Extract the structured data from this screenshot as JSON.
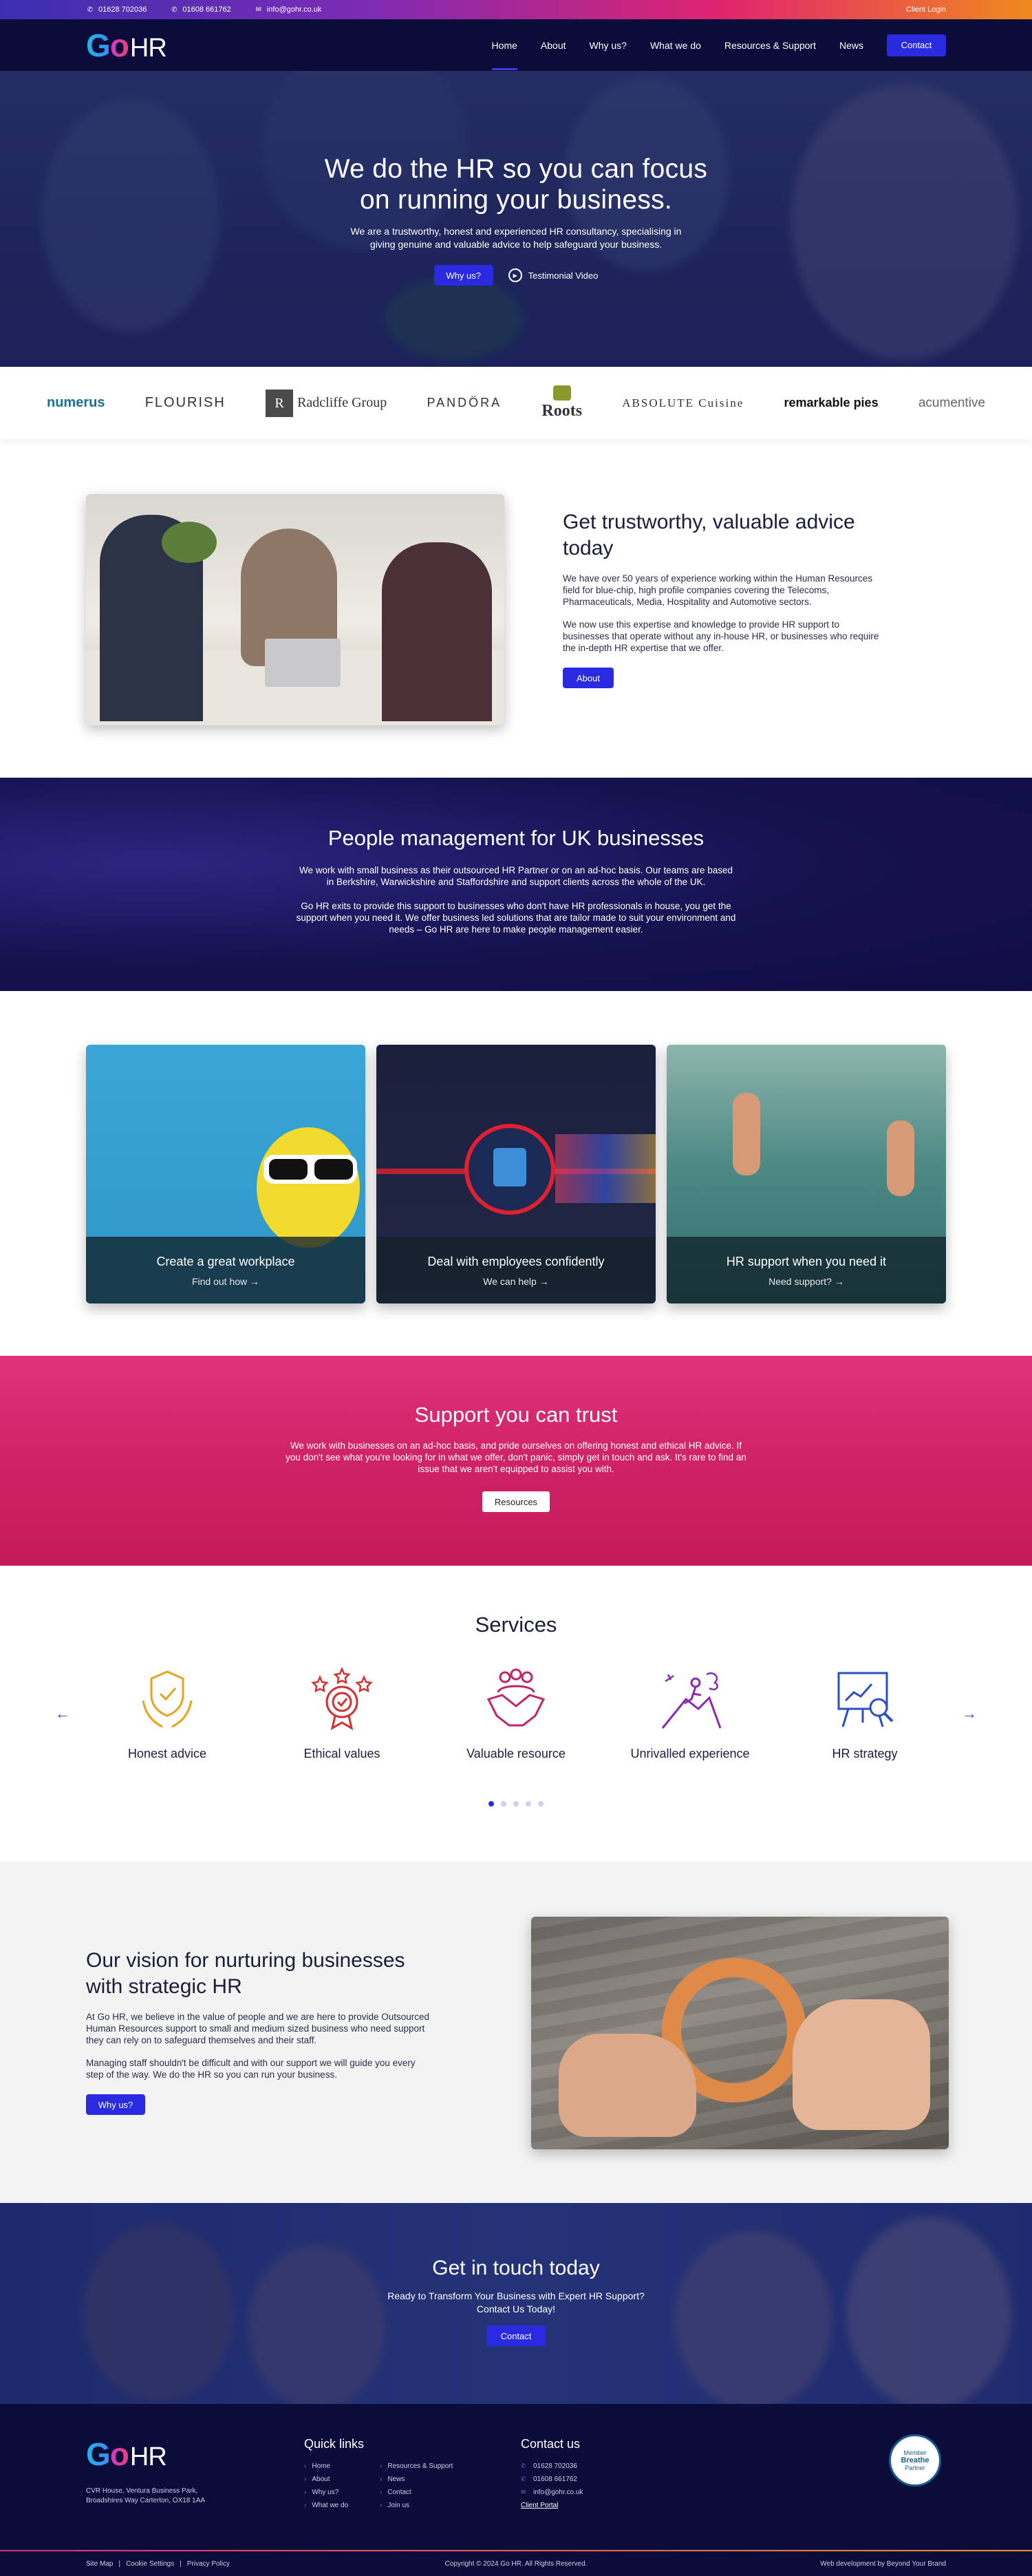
{
  "topbar": {
    "phone1": "01628 702036",
    "phone2": "01608 661762",
    "email": "info@gohr.co.uk",
    "client_login": "Client Login"
  },
  "logo": {
    "g": "G",
    "o": "o",
    "h": "HR"
  },
  "nav": {
    "items": [
      "Home",
      "About",
      "Why us?",
      "What we do",
      "Resources & Support",
      "News"
    ],
    "contact": "Contact"
  },
  "hero": {
    "title_line1": "We do the HR so you can focus",
    "title_line2": "on running your business.",
    "subtitle": "We are a trustworthy, honest and experienced HR consultancy, specialising in giving genuine and valuable advice to help safeguard your business.",
    "why_button": "Why us?",
    "video_link": "Testimonial Video"
  },
  "logos": [
    "numerus",
    "FLOURISH",
    "Radcliffe Group",
    "PANDÖRA",
    "Roots",
    "ABSOLUTE Cuisine",
    "remarkable pies",
    "acumentive"
  ],
  "advice": {
    "title": "Get trustworthy, valuable advice today",
    "para1": "We have over 50 years of experience working within the Human Resources field for blue-chip, high profile companies covering the Telecoms, Pharmaceuticals, Media, Hospitality and Automotive sectors.",
    "para2": "We now use this expertise and knowledge to provide HR support to businesses that operate without any in-house HR, or businesses who require the in-depth HR expertise that we offer.",
    "button": "About"
  },
  "people": {
    "title": "People management for UK businesses",
    "para1": "We work with small business as their outsourced HR Partner or on an ad-hoc basis. Our teams are based in Berkshire, Warwickshire and Staffordshire and support clients across the whole of the UK.",
    "para2": "Go HR exits to provide this support to businesses who don't have HR professionals in house, you get the support when you need it. We offer business led solutions that are tailor made to suit your environment and needs – Go HR are here to make people management easier."
  },
  "cards": [
    {
      "title": "Create a great workplace",
      "link": "Find out how →"
    },
    {
      "title": "Deal with employees confidently",
      "link": "We can help →"
    },
    {
      "title": "HR support when you need it",
      "link": "Need support? →"
    }
  ],
  "support": {
    "title": "Support you can trust",
    "text": "We work with businesses on an ad-hoc basis, and pride ourselves on offering honest and ethical HR advice. If you don't see what you're looking for in what we offer, don't panic, simply get in touch and ask. It's rare to find an issue that we aren't equipped to assist you with.",
    "button": "Resources"
  },
  "services": {
    "title": "Services",
    "items": [
      "Honest advice",
      "Ethical values",
      "Valuable resource",
      "Unrivalled experience",
      "HR strategy"
    ],
    "active_dot": 1,
    "dot_count": 5
  },
  "vision": {
    "title": "Our vision for nurturing businesses with strategic HR",
    "para1": "At Go HR, we believe in the value of people and we are here to provide Outsourced Human Resources support to small and medium sized business who need support they can rely on to safeguard themselves and their staff.",
    "para2": "Managing staff shouldn't be difficult and with our support we will guide you every step of the way. We do the HR so you can run your business.",
    "button": "Why us?"
  },
  "touch": {
    "title": "Get in touch today",
    "text": "Ready to Transform Your Business with Expert HR Support? Contact Us Today!",
    "button": "Contact"
  },
  "footer": {
    "address": "CVR House, Ventura Business Park, Broadshires Way Carterton, OX18 1AA",
    "quick_links_title": "Quick links",
    "quick_links": [
      "Home",
      "Resources & Support",
      "About",
      "News",
      "Why us?",
      "Contact",
      "What we do",
      "Join us"
    ],
    "contact_title": "Contact us",
    "phone1": "01628 702036",
    "phone2": "01608 661762",
    "email": "info@gohr.co.uk",
    "portal": "Client Portal",
    "badge_line1": "Member",
    "badge_line2": "Breathe",
    "badge_line3": "Partner",
    "sitemap": "Site Map",
    "cookie": "Cookie Settings",
    "privacy": "Privacy Policy",
    "copyright": "Copyright © 2024 Go HR. All Rights Reserved.",
    "developer": "Web development by Beyond Your Brand"
  },
  "colors": {
    "navy": "#0c0c3b",
    "accent_blue": "#2a2be0",
    "pink": "#d02266",
    "orange": "#f08a1e"
  }
}
